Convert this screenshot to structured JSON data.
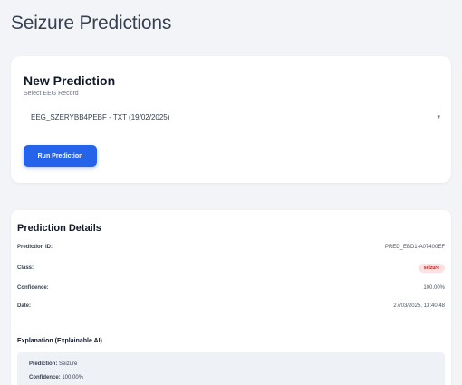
{
  "page": {
    "title": "Seizure Predictions"
  },
  "new_prediction": {
    "heading": "New Prediction",
    "select_label": "Select EEG Record",
    "selected_record": "EEG_SZERYBB4PEBF - TXT (19/02/2025)",
    "run_button": "Run Prediction"
  },
  "details": {
    "heading": "Prediction Details",
    "rows": [
      {
        "label": "Prediction ID:",
        "value": "PRED_EBD1-A07400EF"
      },
      {
        "label": "Class:",
        "value": "seizure"
      },
      {
        "label": "Confidence:",
        "value": "100.00%"
      },
      {
        "label": "Date:",
        "value": "27/03/2025, 13:40:48"
      }
    ]
  },
  "explanation": {
    "heading": "Explanation (Explainable AI)",
    "prediction_label": "Prediction:",
    "prediction_value": "Seizure",
    "confidence_label": "Confidence:",
    "confidence_value": "100.00%"
  },
  "colors": {
    "primary": "#2563eb",
    "background": "#f3f4f7",
    "badge_text": "#b91c1c",
    "badge_bg": "#fee2e2"
  }
}
